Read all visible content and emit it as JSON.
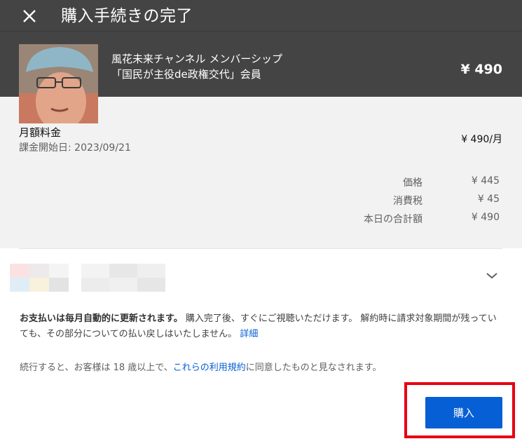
{
  "header": {
    "title": "購入手続きの完了",
    "close_icon": "close-icon",
    "product_line1": "風花未来チャンネル メンバーシップ",
    "product_line2": "「国民が主役de政権交代」会員",
    "product_price": "¥ 490"
  },
  "summary": {
    "plan_label": "月額料金",
    "plan_start": "課金開始日: 2023/09/21",
    "plan_price": "¥ 490/月",
    "breakdown": [
      {
        "label": "価格",
        "value": "¥ 445"
      },
      {
        "label": "消費税",
        "value": "¥ 45"
      },
      {
        "label": "本日の合計額",
        "value": "¥ 490"
      }
    ]
  },
  "payment": {
    "chevron_icon": "chevron-down-icon"
  },
  "notice": {
    "bold": "お支払いは毎月自動的に更新されます。",
    "text": " 購入完了後、すぐにご視聴いただけます。 解約時に請求対象期間が残っていても、その部分についての払い戻しはいたしません。 ",
    "link": "詳細"
  },
  "terms": {
    "before": "続行すると、お客様は 18 歳以上で、",
    "link": "これらの利用規約",
    "after": "に同意したものと見なされます。"
  },
  "buy_button": "購入",
  "colors": {
    "header_bg": "#444444",
    "summary_bg": "#f2f2f2",
    "accent": "#065fd4",
    "highlight": "#e60012"
  }
}
